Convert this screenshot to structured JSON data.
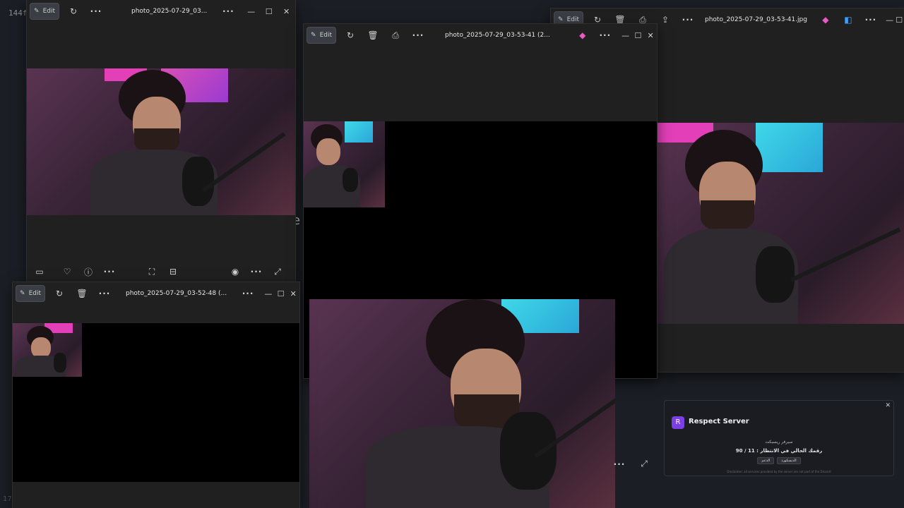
{
  "background": {
    "code_text": "144f",
    "corner_text": "17",
    "glyph": "e"
  },
  "windows": {
    "w1": {
      "edit_label": "Edit",
      "title": "photo_2025-07-29_03..."
    },
    "w2": {
      "edit_label": "Edit",
      "title": "photo_2025-07-29_03-53-41 (2..."
    },
    "w3": {
      "edit_label": "Edit",
      "title": "photo_2025-07-29_03-53-41.jpg"
    },
    "w4": {
      "edit_label": "Edit",
      "title": "photo_2025-07-29_03-52-48 (..."
    }
  },
  "notification": {
    "title": "Respect Server",
    "line1": "سيرفر ريسبكت",
    "line2": "رقمك الحالي في الانتظار : 11 / 90",
    "button1": "الدعم",
    "button2": "الديسكورد",
    "footer": "Disclaimer: all services provided by the server are not part of the Discord"
  },
  "colors": {
    "accent": "#7b3fe4",
    "window_bg": "#202020",
    "desktop": "#1b1e24"
  }
}
